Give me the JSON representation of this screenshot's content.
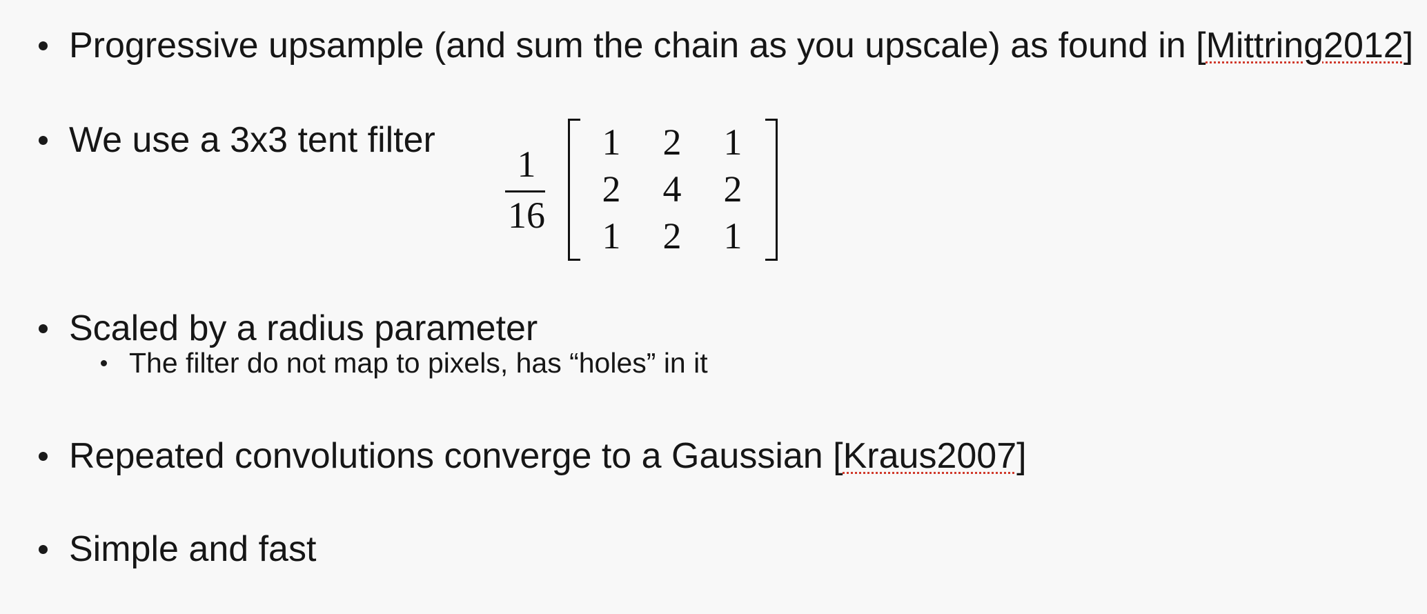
{
  "slide": {
    "bullets": [
      {
        "text_before": "Progressive upsample (and sum the chain as you upscale) as found in [",
        "citation": "Mittring2012",
        "text_after": "]"
      },
      {
        "text": "We use a 3x3 tent filter"
      },
      {
        "text": "Scaled by a radius parameter",
        "sub": "The filter do not map to pixels, has “holes” in it"
      },
      {
        "text_before": "Repeated convolutions converge to a Gaussian [",
        "citation": "Kraus2007",
        "text_after": "]"
      },
      {
        "text": "Simple and fast"
      }
    ],
    "filter": {
      "numerator": "1",
      "denominator": "16",
      "matrix": [
        [
          "1",
          "2",
          "1"
        ],
        [
          "2",
          "4",
          "2"
        ],
        [
          "1",
          "2",
          "1"
        ]
      ]
    }
  }
}
